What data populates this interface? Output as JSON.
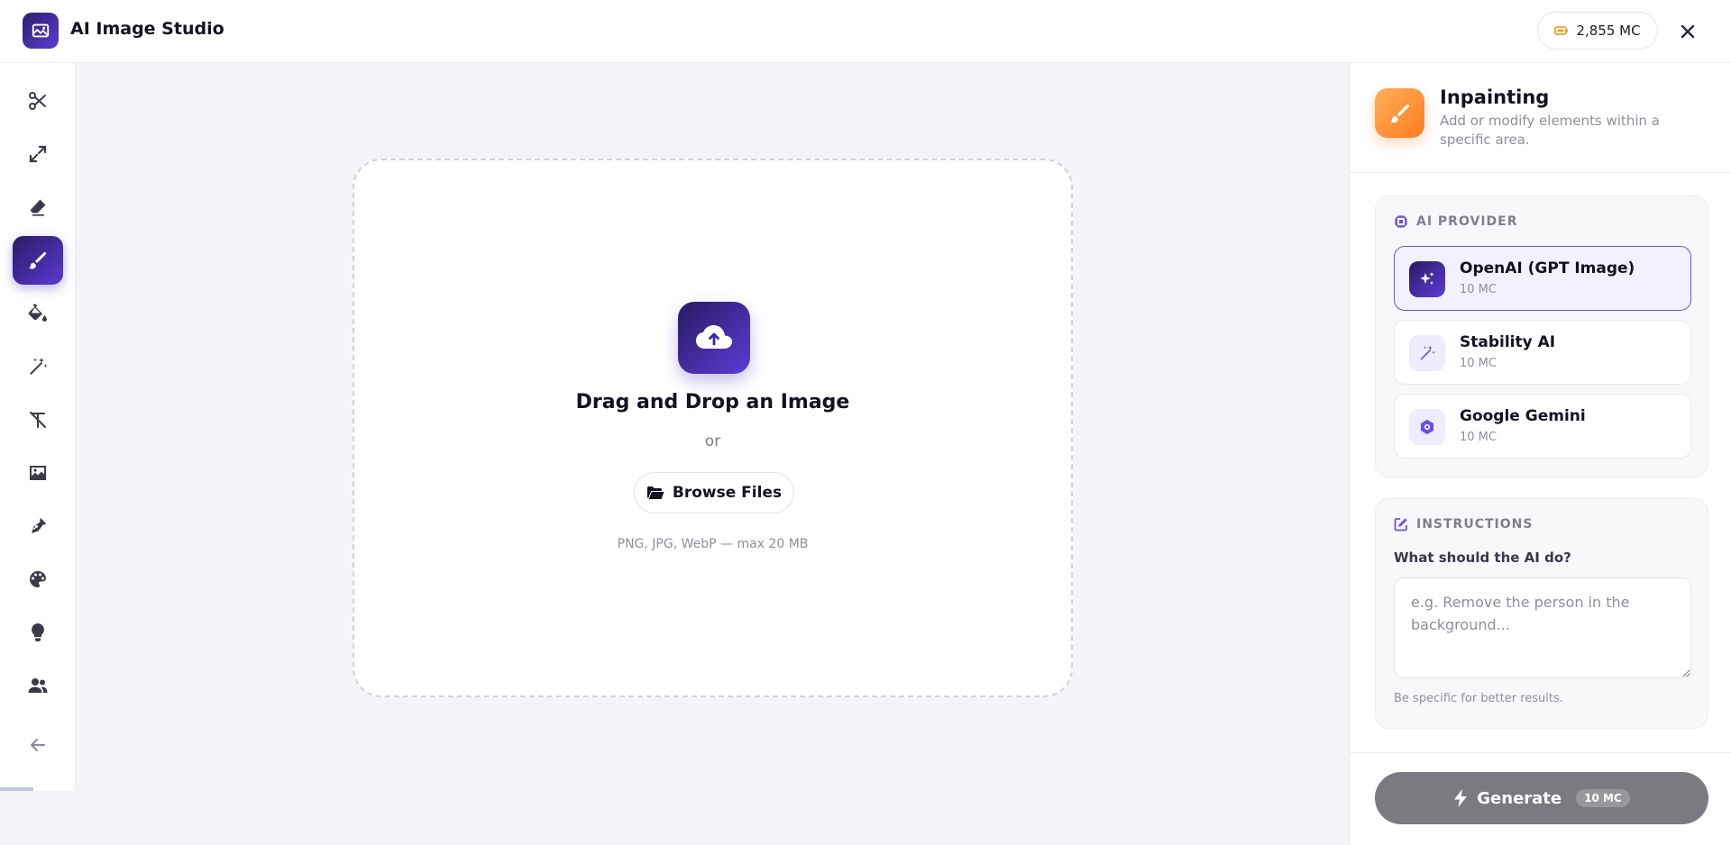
{
  "app": {
    "title": "AI Image Studio",
    "credits": "2,855 MC"
  },
  "sidebar": {
    "tools": [
      {
        "name": "scissors-icon"
      },
      {
        "name": "expand-icon"
      },
      {
        "name": "eraser-icon"
      },
      {
        "name": "brush-icon",
        "active": true
      },
      {
        "name": "paint-bucket-icon"
      },
      {
        "name": "magic-wand-icon"
      },
      {
        "name": "text-remove-icon"
      },
      {
        "name": "image-icon"
      },
      {
        "name": "pen-nib-icon"
      },
      {
        "name": "palette-icon"
      },
      {
        "name": "lightbulb-icon"
      },
      {
        "name": "users-icon"
      }
    ],
    "collapse_icon": "arrow-left-icon"
  },
  "dropzone": {
    "title": "Drag and Drop an Image",
    "or_text": "or",
    "browse_label": "Browse Files",
    "hint": "PNG, JPG, WebP — max 20 MB"
  },
  "panel": {
    "title": "Inpainting",
    "subtitle": "Add or modify elements within a specific area.",
    "provider_label": "AI PROVIDER",
    "providers": [
      {
        "name": "OpenAI (GPT Image)",
        "cost": "10 MC",
        "selected": true
      },
      {
        "name": "Stability AI",
        "cost": "10 MC",
        "selected": false
      },
      {
        "name": "Google Gemini",
        "cost": "10 MC",
        "selected": false
      }
    ],
    "instructions_label": "INSTRUCTIONS",
    "field_label": "What should the AI do?",
    "placeholder": "e.g. Remove the person in the background...",
    "field_hint": "Be specific for better results.",
    "generate_label": "Generate",
    "generate_cost": "10 MC"
  },
  "colors": {
    "accent": "#5b3bd6",
    "accent_dark": "#2b1c63",
    "orange": "#ff8a2a",
    "generate_disabled": "#7b7a80"
  }
}
